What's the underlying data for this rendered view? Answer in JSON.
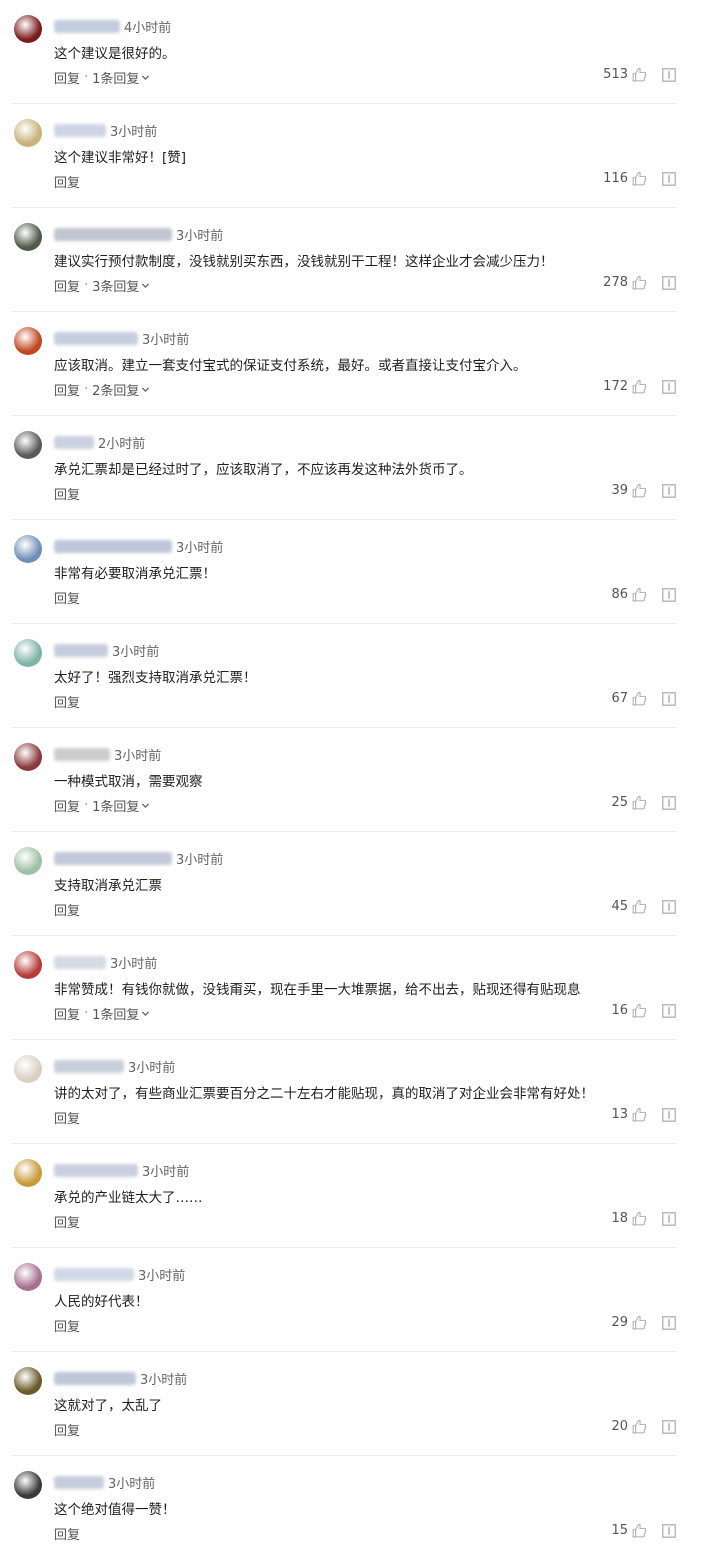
{
  "labels": {
    "reply": "回复",
    "dot": "·"
  },
  "colors": {
    "divider": "#ececec",
    "text": "#1f1f1f",
    "meta": "#666666",
    "icon": "#aaaaaa"
  },
  "comments": [
    {
      "time": "4小时前",
      "text": "这个建议是很好的。",
      "replies": "1条回复",
      "likes": "513",
      "avatar_color": "#7a1c1c",
      "name_blur_color": "#b9c4d8"
    },
    {
      "time": "3小时前",
      "text": "这个建议非常好！[赞]",
      "replies": "",
      "likes": "116",
      "avatar_color": "#c7b27a",
      "name_blur_color": "#c6cde0"
    },
    {
      "time": "3小时前",
      "text": "建议实行预付款制度，没钱就别买东西，没钱就别干工程！这样企业才会减少压力！",
      "replies": "3条回复",
      "likes": "278",
      "avatar_color": "#4f5a4a",
      "name_blur_color": "#b7bcc7"
    },
    {
      "time": "3小时前",
      "text": "应该取消。建立一套支付宝式的保证支付系统，最好。或者直接让支付宝介入。",
      "replies": "2条回复",
      "likes": "172",
      "avatar_color": "#c0471f",
      "name_blur_color": "#bcc6da"
    },
    {
      "time": "2小时前",
      "text": "承兑汇票却是已经过时了，应该取消了，不应该再发这种法外货币了。",
      "replies": "",
      "likes": "39",
      "avatar_color": "#5a5a5a",
      "name_blur_color": "#c2c9db"
    },
    {
      "time": "3小时前",
      "text": "非常有必要取消承兑汇票！",
      "replies": "",
      "likes": "86",
      "avatar_color": "#6f8fb8",
      "name_blur_color": "#b3bed4"
    },
    {
      "time": "3小时前",
      "text": "太好了！强烈支持取消承兑汇票！",
      "replies": "",
      "likes": "67",
      "avatar_color": "#7fb3a8",
      "name_blur_color": "#bcc5d8"
    },
    {
      "time": "3小时前",
      "text": "一种模式取消，需要观察",
      "replies": "1条回复",
      "likes": "25",
      "avatar_color": "#8a3a3a",
      "name_blur_color": "#c4c4c4"
    },
    {
      "time": "3小时前",
      "text": "支持取消承兑汇票",
      "replies": "",
      "likes": "45",
      "avatar_color": "#9fc0a6",
      "name_blur_color": "#b8c0d2"
    },
    {
      "time": "3小时前",
      "text": "非常赞成！有钱你就做，没钱甭买，现在手里一大堆票据，给不出去，贴现还得有贴现息",
      "replies": "1条回复",
      "likes": "16",
      "avatar_color": "#b83a3a",
      "name_blur_color": "#cfd4df"
    },
    {
      "time": "3小时前",
      "text": "讲的太对了，有些商业汇票要百分之二十左右才能贴现，真的取消了对企业会非常有好处！",
      "replies": "",
      "likes": "13",
      "avatar_color": "#d9d0c2",
      "name_blur_color": "#bfc6d6"
    },
    {
      "time": "3小时前",
      "text": "承兑的产业链太大了……",
      "replies": "",
      "likes": "18",
      "avatar_color": "#c99a3a",
      "name_blur_color": "#c2c8da"
    },
    {
      "time": "3小时前",
      "text": "人民的好代表！",
      "replies": "",
      "likes": "29",
      "avatar_color": "#a8708f",
      "name_blur_color": "#c9d3e4"
    },
    {
      "time": "3小时前",
      "text": "这就对了，太乱了",
      "replies": "",
      "likes": "20",
      "avatar_color": "#6b5a2a",
      "name_blur_color": "#b3bdd2"
    },
    {
      "time": "3小时前",
      "text": "这个绝对值得一赞！",
      "replies": "",
      "likes": "15",
      "avatar_color": "#3a3a3a",
      "name_blur_color": "#bcc4d6"
    }
  ]
}
